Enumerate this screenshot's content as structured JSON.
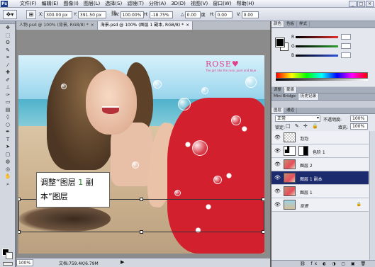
{
  "menubar": {
    "logo": "Ps",
    "menus": [
      "文件(F)",
      "编辑(E)",
      "图像(I)",
      "图层(L)",
      "选择(S)",
      "滤镜(T)",
      "分析(A)",
      "3D(D)",
      "视图(V)",
      "窗口(W)",
      "帮助(H)"
    ],
    "window_buttons": [
      "_",
      "□",
      "×"
    ]
  },
  "options_bar": {
    "x_label": "X:",
    "x_value": "300.00 px",
    "y_label": "Y:",
    "y_value": "391.50 px",
    "w_label": "W:",
    "w_value": "100.00%",
    "h_label": "H:",
    "h_value": "-18.75%",
    "angle_value": "0.00",
    "angle_unit": "度",
    "hskew_label": "H:",
    "hskew_value": "0.00",
    "vskew_label": "V:",
    "vskew_value": "0.00",
    "chain_icon": "link-icon"
  },
  "tabs": [
    {
      "label": "人物.psd @ 100% (背景, RGB/8) *",
      "close": "×",
      "active": false
    },
    {
      "label": "海景.psd @ 100% (图层 1 副本, RGB/8) *",
      "close": "×",
      "active": true
    }
  ],
  "canvas": {
    "logo_text": "ROSE♥",
    "logo_sub": "The girl like the rose, pure and blue"
  },
  "callout": {
    "line1_prefix": "调整“图层",
    "line1_highlight": "1",
    "line1_suffix": "副",
    "line2": "本”图层"
  },
  "status": {
    "zoom": "100%",
    "doc_info": "文档:759.4K/6.79M",
    "arrow": "▶"
  },
  "panels": {
    "color_tabs": [
      "颜色",
      "色板",
      "样式"
    ],
    "color_channels": [
      {
        "label": "R",
        "value": "",
        "color": "#e03030"
      },
      {
        "label": "G",
        "value": "",
        "color": "#30a030"
      },
      {
        "label": "B",
        "value": "",
        "color": "#3050e0"
      }
    ],
    "adjust_tabs": [
      "调整",
      "蒙版"
    ],
    "history_tabs": [
      "Mini Bridge",
      "历史记录"
    ],
    "layers_tabs": [
      "图层",
      "通道"
    ],
    "blend_mode": "正常",
    "opacity_label": "不透明度:",
    "opacity_value": "100%",
    "lock_label": "锁定:",
    "lock_icons": "□ ✎ ✛ 🔒",
    "fill_label": "填充:",
    "fill_value": "100%",
    "layers": [
      {
        "name": "泡泡",
        "thumb": "transparent",
        "selected": false
      },
      {
        "name": "色阶 1",
        "thumb": "adjustment",
        "mask": true,
        "selected": false
      },
      {
        "name": "图层 2",
        "thumb": "photo",
        "selected": false
      },
      {
        "name": "图层 1 副本",
        "thumb": "photo",
        "selected": true
      },
      {
        "name": "图层 1",
        "thumb": "photo",
        "selected": false
      },
      {
        "name": "背景",
        "thumb": "background",
        "locked": true,
        "selected": false
      }
    ],
    "footer_icons": "⛓ fx ◐ ◑ ▢ ▣ 🗑"
  }
}
